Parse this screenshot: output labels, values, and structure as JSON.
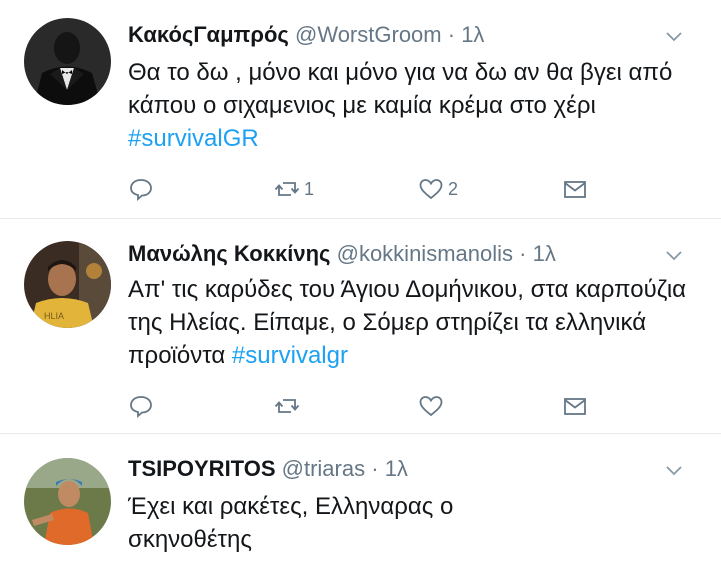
{
  "tweets": [
    {
      "name": "ΚακόςΓαμπρός",
      "handle": "@WorstGroom",
      "dot": "·",
      "time": "1λ",
      "text_plain": "Θα το δω , μόνο και μόνο για να δω αν θα βγει από κάπου ο σιχαμενιος με καμία κρέμα στο χέρι ",
      "hashtag": "#survivalGR",
      "reply_count": "",
      "retweet_count": "1",
      "like_count": "2",
      "avatar_desc": "man in black tuxedo with bow tie"
    },
    {
      "name": "Μανώλης Κοκκίνης",
      "handle": "@kokkinismanolis",
      "dot": "·",
      "time": "1λ",
      "text_plain": "Απ' τις καρύδες του Άγιου Δομήνικου, στα καρπούζια της Ηλείας. Είπαμε, ο Σόμερ στηρίζει τα ελληνικά προϊόντα ",
      "hashtag": "#survivalgr",
      "reply_count": "",
      "retweet_count": "",
      "like_count": "",
      "avatar_desc": "man in yellow t-shirt"
    },
    {
      "name": "TSIPOYRITOS",
      "handle": "@triaras",
      "dot": "·",
      "time": "1λ",
      "text_plain": "Έχει και ρακέτες,  Ελληναρας ο σκηνοθέτης",
      "hashtag": "",
      "avatar_desc": "man in orange shirt with blue hat outdoors"
    }
  ],
  "colors": {
    "text": "#14171a",
    "secondary": "#657786",
    "link": "#1da1f2",
    "divider": "#e6ecf0"
  },
  "icons": [
    "reply-icon",
    "retweet-icon",
    "like-icon",
    "message-icon",
    "chevron-down-icon"
  ]
}
